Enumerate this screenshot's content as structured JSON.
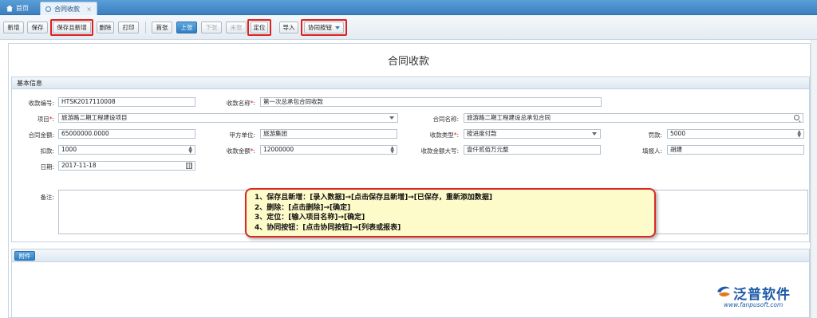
{
  "tabs": [
    {
      "label": "首页",
      "icon": "home-icon"
    },
    {
      "label": "合同收款",
      "icon": "document-icon",
      "close": "×"
    }
  ],
  "toolbar": {
    "add": "新增",
    "save": "保存",
    "save_and_add": "保存且新增",
    "delete": "删除",
    "print": "打印",
    "first": "首张",
    "prev": "上张",
    "next": "下张",
    "last": "末张",
    "locate": "定位",
    "import": "导入",
    "collab": "协同按钮"
  },
  "page_title": "合同收款",
  "section_basic": "基本信息",
  "form": {
    "receipt_no": {
      "label": "收款编号:",
      "value": "HTSK2017110008"
    },
    "receipt_name": {
      "label": "收款名称",
      "value": "第一次总承包合同收款"
    },
    "project": {
      "label": "项目",
      "value": "旅游路二期工程建设项目"
    },
    "contract_name": {
      "label": "合同名称:",
      "value": "旅游路二期工程建设总承包合同"
    },
    "contract_amount": {
      "label": "合同金额:",
      "value": "65000000.0000"
    },
    "party_a": {
      "label": "甲方单位:",
      "value": "旅游集团"
    },
    "receipt_type": {
      "label": "收款类型",
      "value": "按进度付款"
    },
    "penalty": {
      "label": "罚款:",
      "value": "5000"
    },
    "deduction": {
      "label": "扣款:",
      "value": "1000"
    },
    "receipt_amount": {
      "label": "收款金额",
      "value": "12000000"
    },
    "amount_upper": {
      "label": "收款金额大写:",
      "value": "壹仟贰佰万元整"
    },
    "filler": {
      "label": "填报人:",
      "value": "胡建"
    },
    "date": {
      "label": "日期:",
      "value": "2017-11-18"
    },
    "remark": {
      "label": "备注:"
    }
  },
  "required_mark": "*",
  "callout": {
    "lines": [
      "1、保存且新增：[录入数据]→[点击保存且新增]→[已保存，重新添加数据]",
      "2、删除：[点击删除]→[确定]",
      "3、定位：[输入项目名称]→[确定]",
      "4、协同按钮：[点击协同按钮]→[列表或报表]"
    ]
  },
  "attachment": "附件",
  "logo": {
    "name": "泛普软件",
    "url": "www.fanpusoft.com"
  },
  "colors": {
    "accent": "#3b7fc0",
    "highlight_border": "#e0201c",
    "callout_bg": "#fdfbc9"
  }
}
